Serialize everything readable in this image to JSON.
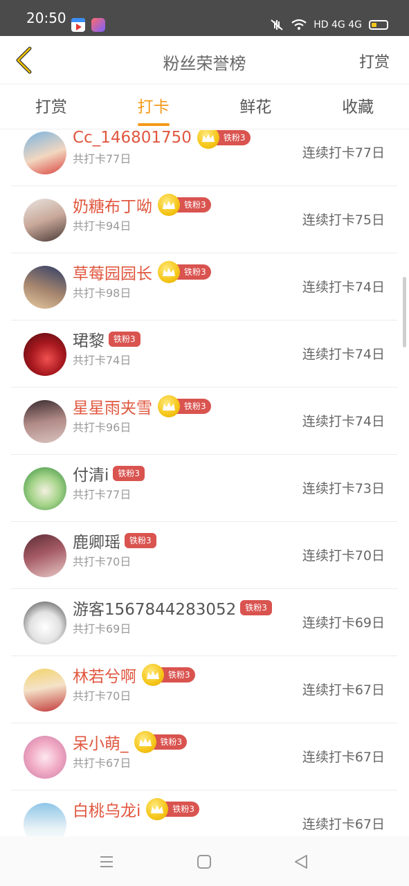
{
  "status_bar": {
    "time": "20:50",
    "network": "HD 4G 4G"
  },
  "header": {
    "title": "粉丝荣誉榜",
    "action": "打赏"
  },
  "tabs": [
    {
      "label": "打赏",
      "active": false
    },
    {
      "label": "打卡",
      "active": true
    },
    {
      "label": "鲜花",
      "active": false
    },
    {
      "label": "收藏",
      "active": false
    }
  ],
  "rows": [
    {
      "name": "Cc_146801750",
      "crown": true,
      "badge": "铁粉3",
      "total": "共打卡77日",
      "streak": "连续打卡77日"
    },
    {
      "name": "奶糖布丁呦",
      "crown": true,
      "badge": "铁粉3",
      "total": "共打卡94日",
      "streak": "连续打卡75日"
    },
    {
      "name": "草莓园园长",
      "crown": true,
      "badge": "铁粉3",
      "total": "共打卡98日",
      "streak": "连续打卡74日"
    },
    {
      "name": "珺黎",
      "crown": false,
      "badge": "铁粉3",
      "total": "共打卡74日",
      "streak": "连续打卡74日"
    },
    {
      "name": "星星雨夹雪",
      "crown": true,
      "badge": "铁粉3",
      "total": "共打卡96日",
      "streak": "连续打卡74日"
    },
    {
      "name": "付清i",
      "crown": false,
      "badge": "铁粉3",
      "total": "共打卡77日",
      "streak": "连续打卡73日"
    },
    {
      "name": "鹿卿瑶",
      "crown": false,
      "badge": "铁粉3",
      "total": "共打卡70日",
      "streak": "连续打卡70日"
    },
    {
      "name": "游客1567844283052",
      "crown": false,
      "badge": "铁粉3",
      "total": "共打卡69日",
      "streak": "连续打卡69日"
    },
    {
      "name": "林若兮啊",
      "crown": true,
      "badge": "铁粉3",
      "total": "共打卡70日",
      "streak": "连续打卡67日"
    },
    {
      "name": "呆小萌_",
      "crown": true,
      "badge": "铁粉3",
      "total": "共打卡67日",
      "streak": "连续打卡67日"
    },
    {
      "name": "白桃乌龙i",
      "crown": true,
      "badge": "铁粉3",
      "total": "",
      "streak": "连续打卡67日"
    }
  ],
  "colors": {
    "accent": "#f4991a",
    "name_highlight": "#e0573f",
    "badge": "#d9534f",
    "crown": "#f5c518"
  }
}
